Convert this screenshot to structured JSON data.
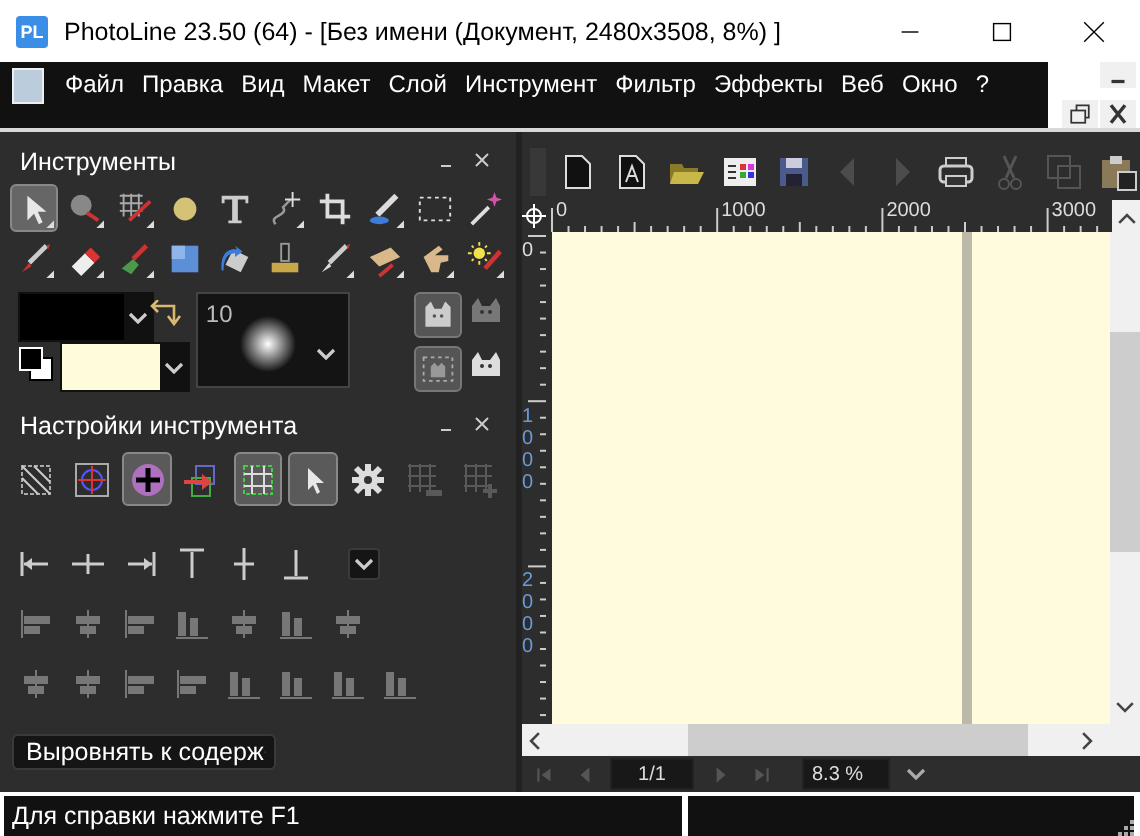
{
  "window": {
    "app_icon": "PL",
    "title": "PhotoLine 23.50 (64) - [Без имени (Документ, 2480x3508, 8%) ]"
  },
  "menu": [
    "Файл",
    "Правка",
    "Вид",
    "Макет",
    "Слой",
    "Инструмент",
    "Фильтр",
    "Эффекты",
    "Веб",
    "Окно",
    "?"
  ],
  "tools_panel": {
    "title": "Инструменты",
    "tools": [
      {
        "selected": true
      },
      {
        "selected": false
      },
      {
        "selected": false
      },
      {
        "selected": false
      },
      {
        "selected": false
      },
      {
        "selected": false
      },
      {
        "selected": false
      },
      {
        "selected": false
      },
      {
        "selected": false
      },
      {
        "selected": false
      },
      {
        "selected": false
      },
      {
        "selected": false
      },
      {
        "selected": false
      },
      {
        "selected": false
      },
      {
        "selected": false
      },
      {
        "selected": false
      },
      {
        "selected": false
      },
      {
        "selected": false
      },
      {
        "selected": false
      },
      {
        "selected": false
      }
    ],
    "brush_size": "10",
    "mask_modes": [
      {
        "on": true
      },
      {
        "on": true
      }
    ]
  },
  "settings_panel": {
    "title": "Настройки инструмента",
    "options": [
      {
        "on": false,
        "disabled": false
      },
      {
        "on": false,
        "disabled": false
      },
      {
        "on": true,
        "disabled": false
      },
      {
        "on": false,
        "disabled": false
      },
      {
        "on": true,
        "disabled": false
      },
      {
        "on": true,
        "disabled": false
      },
      {
        "on": false,
        "disabled": false
      },
      {
        "on": false,
        "disabled": true
      },
      {
        "on": false,
        "disabled": true
      }
    ],
    "align_rows": [
      {
        "disabled": false
      },
      {
        "disabled": true
      },
      {
        "disabled": true
      }
    ],
    "align_mode": "Выровнять к содерж"
  },
  "toolbar": [
    {
      "disabled": false
    },
    {
      "disabled": false
    },
    {
      "disabled": false
    },
    {
      "disabled": false
    },
    {
      "disabled": false
    },
    {
      "disabled": true
    },
    {
      "disabled": true
    },
    {
      "disabled": false
    },
    {
      "disabled": true
    },
    {
      "disabled": true
    },
    {
      "disabled": false
    }
  ],
  "ruler": {
    "x_labels": [
      "0",
      "1000",
      "2000",
      "3000"
    ],
    "y_labels": [
      "0",
      "1000",
      "2000"
    ]
  },
  "navigator": {
    "page": "1/1",
    "zoom": "8.3 %"
  },
  "status_bar": {
    "help": "Для справки нажмите F1"
  }
}
